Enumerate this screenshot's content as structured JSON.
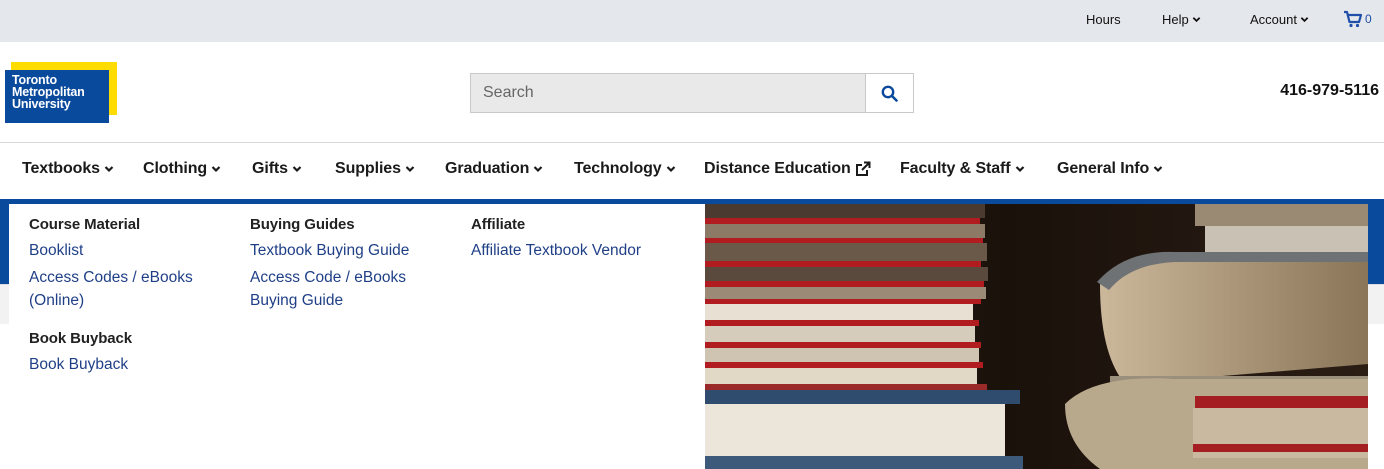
{
  "utility": {
    "hours": "Hours",
    "help": "Help",
    "account": "Account",
    "cart_count": "0"
  },
  "header": {
    "logo_lines": [
      "Toronto",
      "Metropolitan",
      "University"
    ],
    "search_placeholder": "Search",
    "phone": "416-979-5116"
  },
  "nav": [
    {
      "label": "Textbooks"
    },
    {
      "label": "Clothing"
    },
    {
      "label": "Gifts"
    },
    {
      "label": "Supplies"
    },
    {
      "label": "Graduation"
    },
    {
      "label": "Technology"
    },
    {
      "label": "Distance Education"
    },
    {
      "label": "Faculty & Staff"
    },
    {
      "label": "General Info"
    }
  ],
  "mega": {
    "col1": {
      "heading1": "Course Material",
      "links1": [
        "Booklist",
        "Access Codes / eBooks (Online)"
      ],
      "heading2": "Book Buyback",
      "links2": [
        "Book Buyback"
      ]
    },
    "col2": {
      "heading": "Buying Guides",
      "links": [
        "Textbook Buying Guide",
        "Access Code / eBooks Buying Guide"
      ]
    },
    "col3": {
      "heading": "Affiliate",
      "links": [
        "Affiliate Textbook Vendor"
      ]
    }
  },
  "colors": {
    "brand_blue": "#0a4a9c",
    "brand_yellow": "#ffdc00",
    "link": "#1f3f87"
  }
}
